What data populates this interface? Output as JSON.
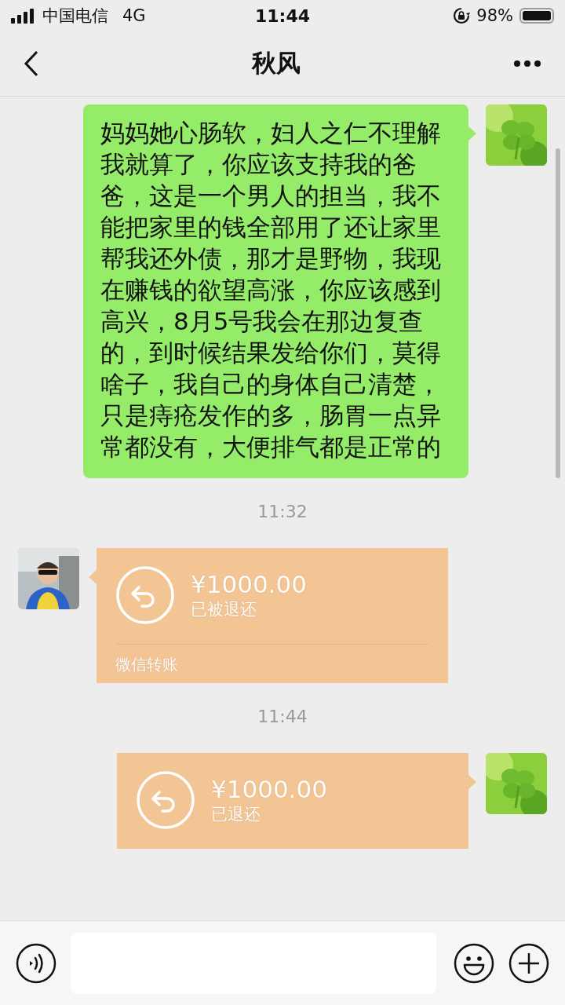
{
  "status_bar": {
    "carrier": "中国电信",
    "network": "4G",
    "time": "11:44",
    "battery": "98%"
  },
  "nav": {
    "title": "秋风"
  },
  "messages": [
    {
      "kind": "text",
      "outgoing": true,
      "text": "妈妈她心肠软，妇人之仁不理解我就算了，你应该支持我的爸爸，这是一个男人的担当，我不能把家里的钱全部用了还让家里帮我还外债，那才是野物，我现在赚钱的欲望高涨，你应该感到高兴，8月5号我会在那边复查的，到时候结果发给你们，莫得啥子，我自己的身体自己清楚，只是痔疮发作的多，肠胃一点异常都没有，大便排气都是正常的"
    },
    {
      "kind": "time",
      "text": "11:32"
    },
    {
      "kind": "transfer",
      "outgoing": false,
      "amount": "¥1000.00",
      "status": "已被退还",
      "footer": "微信转账"
    },
    {
      "kind": "time",
      "text": "11:44"
    },
    {
      "kind": "transfer",
      "outgoing": true,
      "amount": "¥1000.00",
      "status": "已退还"
    }
  ]
}
